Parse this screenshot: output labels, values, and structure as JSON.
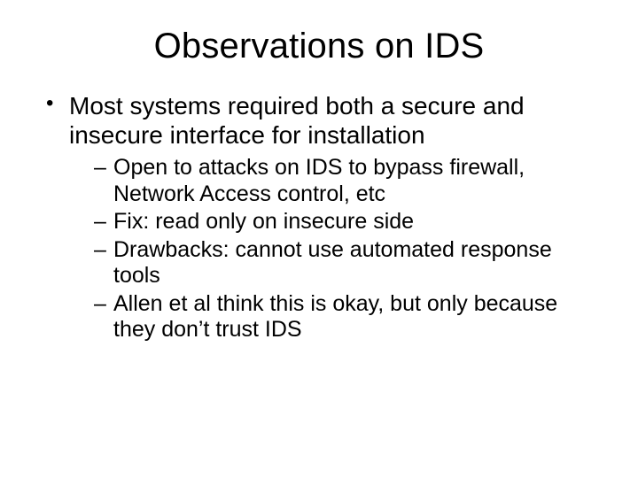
{
  "title": "Observations on IDS",
  "bullets": [
    {
      "text": "Most systems required both a secure and insecure interface for installation",
      "sub": [
        "Open to attacks on IDS to bypass firewall, Network Access control, etc",
        "Fix: read only on insecure side",
        "Drawbacks: cannot use automated response tools",
        "Allen et al think this is okay, but only because they don’t trust IDS"
      ]
    }
  ]
}
